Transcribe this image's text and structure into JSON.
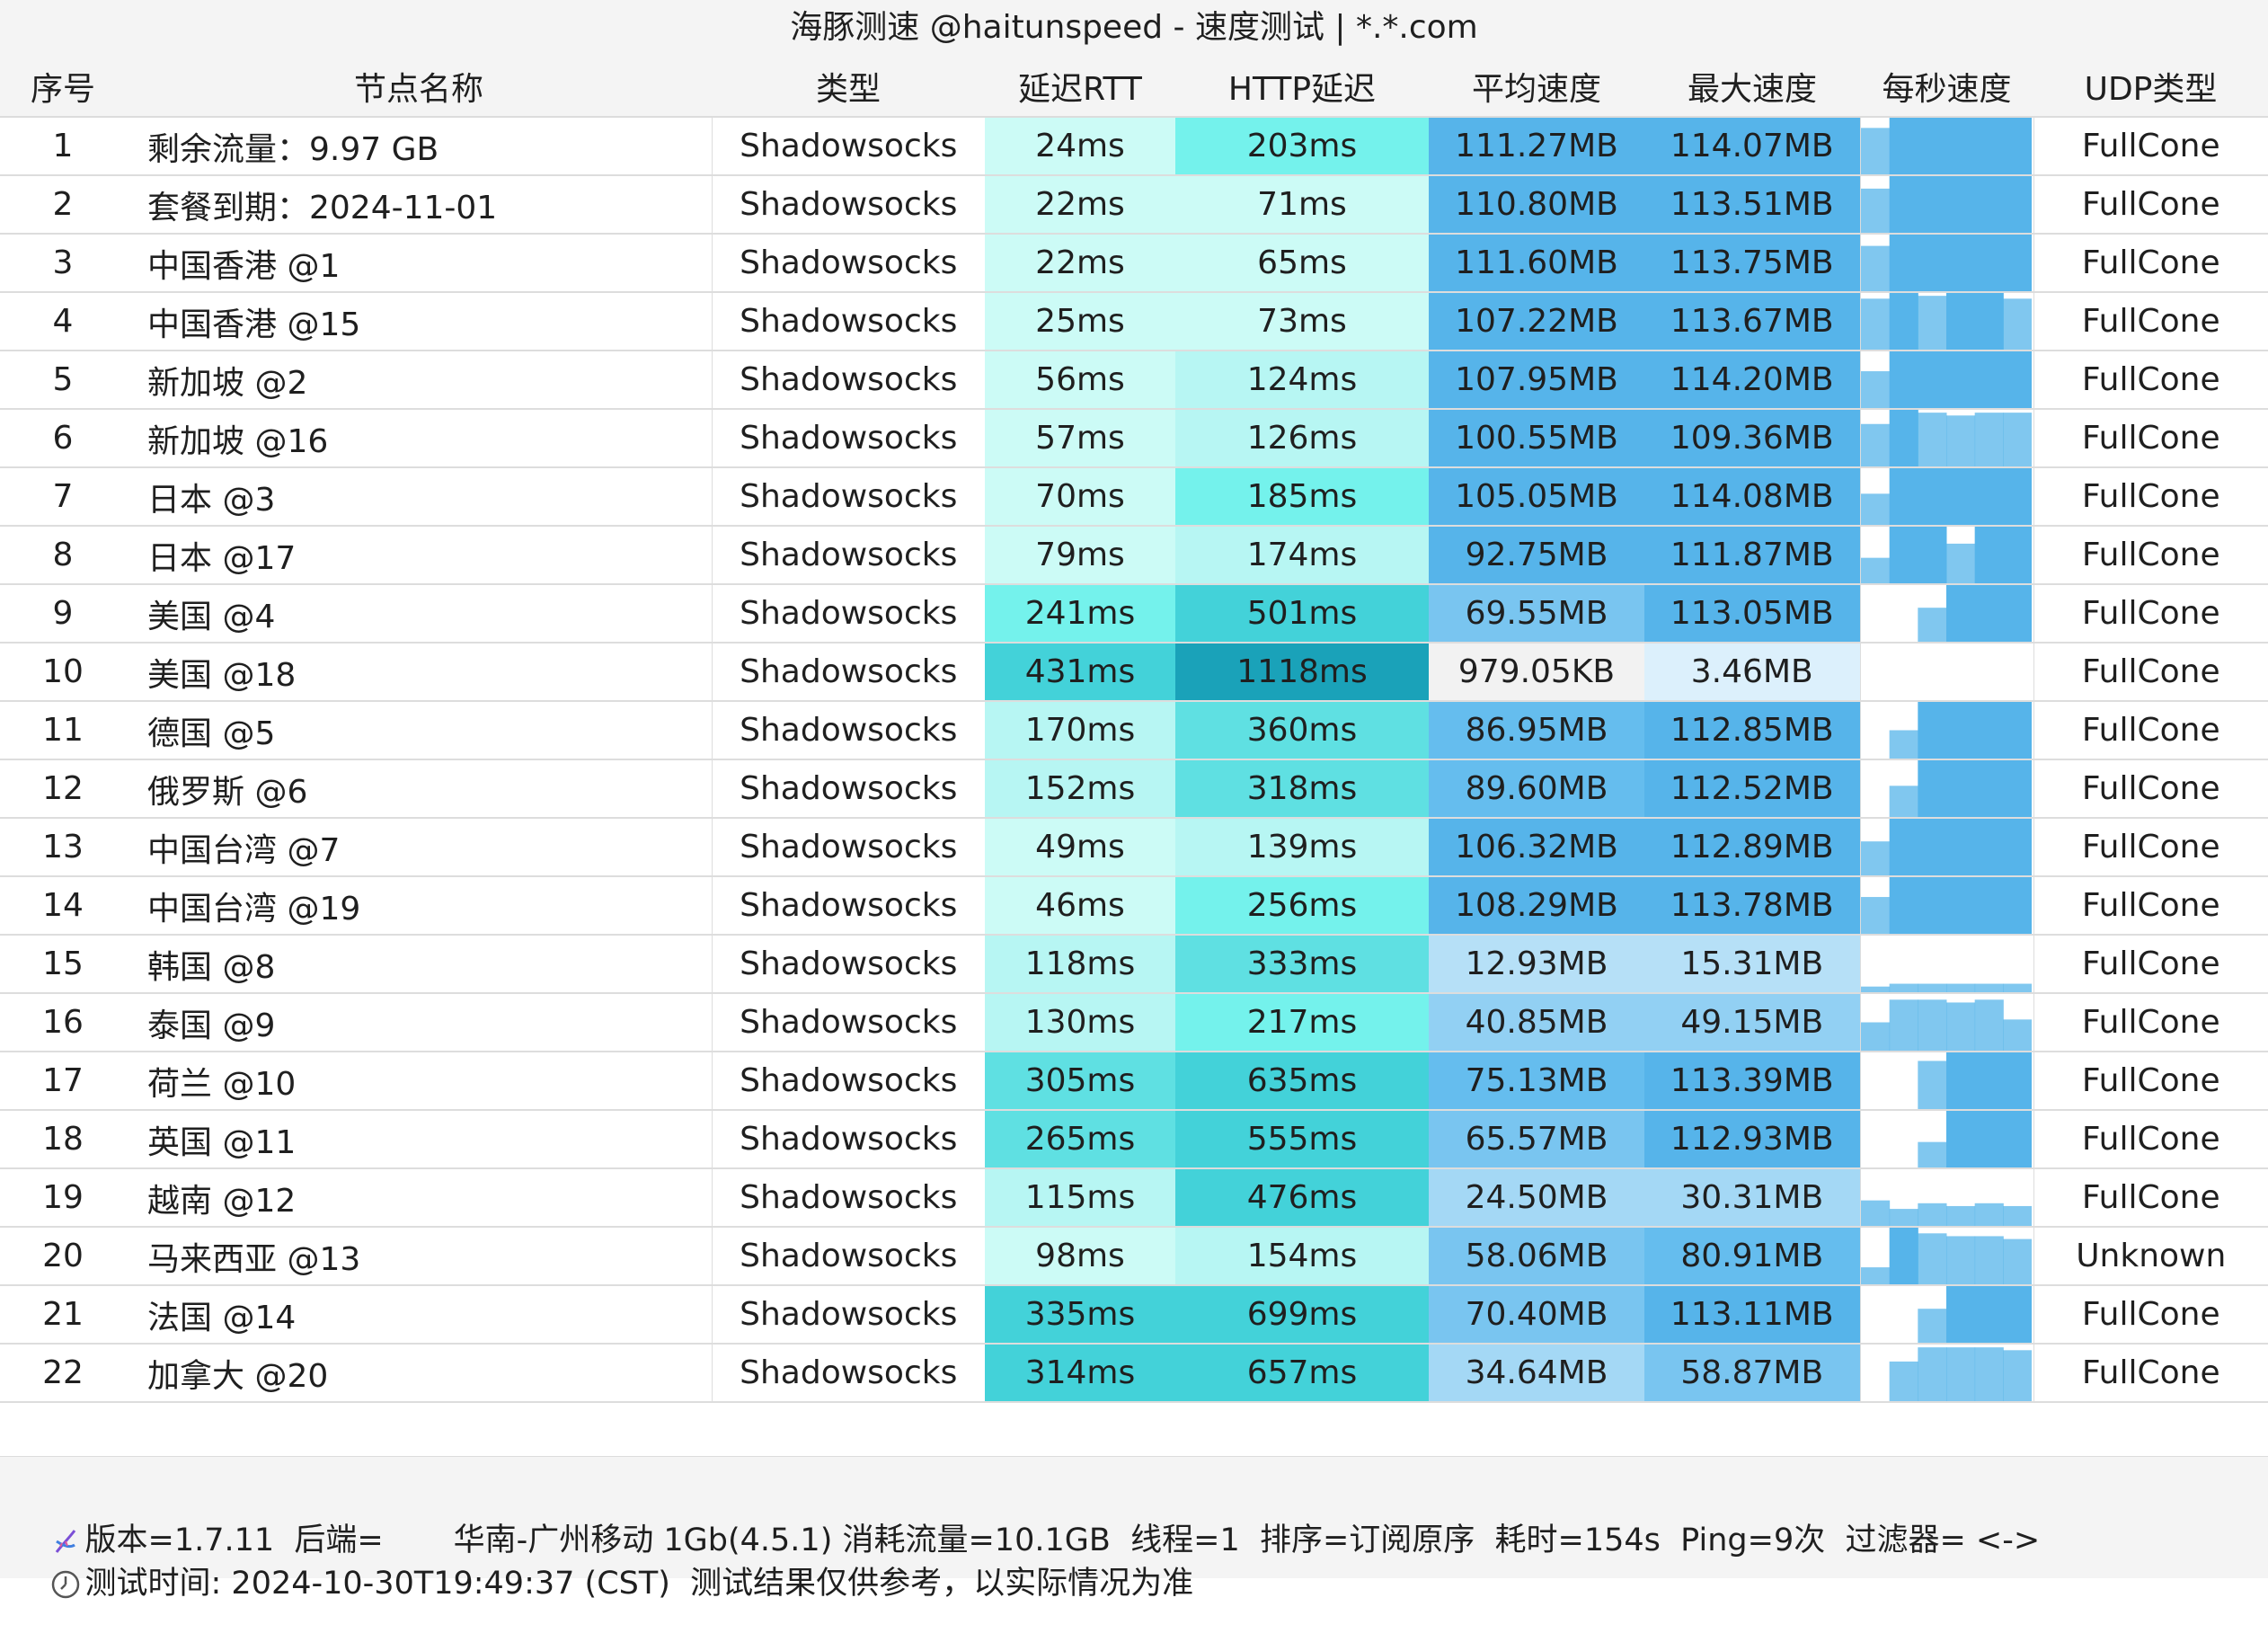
{
  "title": "海豚测速 @haitunspeed - 速度测试 | *.*.com",
  "columns": [
    "序号",
    "节点名称",
    "类型",
    "延迟RTT",
    "HTTP延迟",
    "平均速度",
    "最大速度",
    "每秒速度",
    "UDP类型"
  ],
  "rows": [
    {
      "idx": "1",
      "name": "剩余流量：9.97 GB",
      "type": "Shadowsocks",
      "rtt": "24ms",
      "http": "203ms",
      "avg": "111.27MB",
      "max": "114.07MB",
      "udp": "FullCone",
      "rtt_color": "#ccfbf6",
      "http_color": "#74f2ec",
      "avg_color": "#56b4ea",
      "max_color": "#56b4ea",
      "spark": [
        0.82,
        1,
        1,
        1,
        1,
        1
      ]
    },
    {
      "idx": "2",
      "name": "套餐到期：2024-11-01",
      "type": "Shadowsocks",
      "rtt": "22ms",
      "http": "71ms",
      "avg": "110.80MB",
      "max": "113.51MB",
      "udp": "FullCone",
      "rtt_color": "#ccfbf6",
      "http_color": "#ccfbf6",
      "avg_color": "#56b4ea",
      "max_color": "#56b4ea",
      "spark": [
        0.78,
        1,
        1,
        1,
        1,
        1
      ]
    },
    {
      "idx": "3",
      "name": "中国香港 @1",
      "type": "Shadowsocks",
      "rtt": "22ms",
      "http": "65ms",
      "avg": "111.60MB",
      "max": "113.75MB",
      "udp": "FullCone",
      "rtt_color": "#ccfbf6",
      "http_color": "#ccfbf6",
      "avg_color": "#56b4ea",
      "max_color": "#56b4ea",
      "spark": [
        0.8,
        1,
        1,
        1,
        1,
        1
      ]
    },
    {
      "idx": "4",
      "name": "中国香港 @15",
      "type": "Shadowsocks",
      "rtt": "25ms",
      "http": "73ms",
      "avg": "107.22MB",
      "max": "113.67MB",
      "udp": "FullCone",
      "rtt_color": "#ccfbf6",
      "http_color": "#ccfbf6",
      "avg_color": "#56b4ea",
      "max_color": "#56b4ea",
      "spark": [
        0.9,
        1,
        0.95,
        1,
        1,
        0.9
      ]
    },
    {
      "idx": "5",
      "name": "新加坡 @2",
      "type": "Shadowsocks",
      "rtt": "56ms",
      "http": "124ms",
      "avg": "107.95MB",
      "max": "114.20MB",
      "udp": "FullCone",
      "rtt_color": "#ccfbf6",
      "http_color": "#b7f6f3",
      "avg_color": "#56b4ea",
      "max_color": "#56b4ea",
      "spark": [
        0.65,
        1,
        1,
        1,
        1,
        1
      ]
    },
    {
      "idx": "6",
      "name": "新加坡 @16",
      "type": "Shadowsocks",
      "rtt": "57ms",
      "http": "126ms",
      "avg": "100.55MB",
      "max": "109.36MB",
      "udp": "FullCone",
      "rtt_color": "#ccfbf6",
      "http_color": "#b7f6f3",
      "avg_color": "#56b4ea",
      "max_color": "#56b4ea",
      "spark": [
        0.75,
        1,
        0.95,
        0.9,
        0.95,
        0.95
      ]
    },
    {
      "idx": "7",
      "name": "日本 @3",
      "type": "Shadowsocks",
      "rtt": "70ms",
      "http": "185ms",
      "avg": "105.05MB",
      "max": "114.08MB",
      "udp": "FullCone",
      "rtt_color": "#ccfbf6",
      "http_color": "#74f2ec",
      "avg_color": "#56b4ea",
      "max_color": "#56b4ea",
      "spark": [
        0.55,
        1,
        1,
        1,
        1,
        1
      ]
    },
    {
      "idx": "8",
      "name": "日本 @17",
      "type": "Shadowsocks",
      "rtt": "79ms",
      "http": "174ms",
      "avg": "92.75MB",
      "max": "111.87MB",
      "udp": "FullCone",
      "rtt_color": "#ccfbf6",
      "http_color": "#b7f6f3",
      "avg_color": "#56b4ea",
      "max_color": "#56b4ea",
      "spark": [
        0.45,
        1,
        1,
        0.7,
        1,
        1
      ]
    },
    {
      "idx": "9",
      "name": "美国 @4",
      "type": "Shadowsocks",
      "rtt": "241ms",
      "http": "501ms",
      "avg": "69.55MB",
      "max": "113.05MB",
      "udp": "FullCone",
      "rtt_color": "#74f2ec",
      "http_color": "#43d2d9",
      "avg_color": "#79c5f0",
      "max_color": "#56b4ea",
      "spark": [
        0,
        0,
        0.6,
        1,
        1,
        1
      ]
    },
    {
      "idx": "10",
      "name": "美国 @18",
      "type": "Shadowsocks",
      "rtt": "431ms",
      "http": "1118ms",
      "avg": "979.05KB",
      "max": "3.46MB",
      "udp": "FullCone",
      "rtt_color": "#43d2d9",
      "http_color": "#1aa2b9",
      "avg_color": "#f2f2f2",
      "max_color": "#dcf0fc",
      "spark": [
        0,
        0,
        0,
        0,
        0,
        0
      ]
    },
    {
      "idx": "11",
      "name": "德国 @5",
      "type": "Shadowsocks",
      "rtt": "170ms",
      "http": "360ms",
      "avg": "86.95MB",
      "max": "112.85MB",
      "udp": "FullCone",
      "rtt_color": "#b7f6f3",
      "http_color": "#5fe0e2",
      "avg_color": "#65bdee",
      "max_color": "#56b4ea",
      "spark": [
        0,
        0.5,
        1,
        1,
        1,
        1
      ]
    },
    {
      "idx": "12",
      "name": "俄罗斯 @6",
      "type": "Shadowsocks",
      "rtt": "152ms",
      "http": "318ms",
      "avg": "89.60MB",
      "max": "112.52MB",
      "udp": "FullCone",
      "rtt_color": "#b7f6f3",
      "http_color": "#5fe0e2",
      "avg_color": "#65bdee",
      "max_color": "#56b4ea",
      "spark": [
        0,
        0.55,
        1,
        1,
        1,
        1
      ]
    },
    {
      "idx": "13",
      "name": "中国台湾 @7",
      "type": "Shadowsocks",
      "rtt": "49ms",
      "http": "139ms",
      "avg": "106.32MB",
      "max": "112.89MB",
      "udp": "FullCone",
      "rtt_color": "#ccfbf6",
      "http_color": "#b7f6f3",
      "avg_color": "#56b4ea",
      "max_color": "#56b4ea",
      "spark": [
        0.6,
        1,
        1,
        1,
        1,
        1
      ]
    },
    {
      "idx": "14",
      "name": "中国台湾 @19",
      "type": "Shadowsocks",
      "rtt": "46ms",
      "http": "256ms",
      "avg": "108.29MB",
      "max": "113.78MB",
      "udp": "FullCone",
      "rtt_color": "#ccfbf6",
      "http_color": "#74f2ec",
      "avg_color": "#56b4ea",
      "max_color": "#56b4ea",
      "spark": [
        0.65,
        1,
        1,
        1,
        1,
        1
      ]
    },
    {
      "idx": "15",
      "name": "韩国 @8",
      "type": "Shadowsocks",
      "rtt": "118ms",
      "http": "333ms",
      "avg": "12.93MB",
      "max": "15.31MB",
      "udp": "FullCone",
      "rtt_color": "#b7f6f3",
      "http_color": "#5fe0e2",
      "avg_color": "#b6e0f7",
      "max_color": "#b6e0f7",
      "spark": [
        0.1,
        0.15,
        0.15,
        0.15,
        0.15,
        0.15
      ]
    },
    {
      "idx": "16",
      "name": "泰国 @9",
      "type": "Shadowsocks",
      "rtt": "130ms",
      "http": "217ms",
      "avg": "40.85MB",
      "max": "49.15MB",
      "udp": "FullCone",
      "rtt_color": "#b7f6f3",
      "http_color": "#74f2ec",
      "avg_color": "#92d0f3",
      "max_color": "#92d0f3",
      "spark": [
        0.5,
        0.9,
        0.9,
        0.85,
        0.9,
        0.55
      ]
    },
    {
      "idx": "17",
      "name": "荷兰 @10",
      "type": "Shadowsocks",
      "rtt": "305ms",
      "http": "635ms",
      "avg": "75.13MB",
      "max": "113.39MB",
      "udp": "FullCone",
      "rtt_color": "#5fe0e2",
      "http_color": "#43d2d9",
      "avg_color": "#65bdee",
      "max_color": "#56b4ea",
      "spark": [
        0,
        0,
        0.85,
        1,
        1,
        1
      ]
    },
    {
      "idx": "18",
      "name": "英国 @11",
      "type": "Shadowsocks",
      "rtt": "265ms",
      "http": "555ms",
      "avg": "65.57MB",
      "max": "112.93MB",
      "udp": "FullCone",
      "rtt_color": "#5fe0e2",
      "http_color": "#43d2d9",
      "avg_color": "#79c5f0",
      "max_color": "#56b4ea",
      "spark": [
        0,
        0,
        0.45,
        1,
        1,
        1
      ]
    },
    {
      "idx": "19",
      "name": "越南 @12",
      "type": "Shadowsocks",
      "rtt": "115ms",
      "http": "476ms",
      "avg": "24.50MB",
      "max": "30.31MB",
      "udp": "FullCone",
      "rtt_color": "#b7f6f3",
      "http_color": "#43d2d9",
      "avg_color": "#a4d8f5",
      "max_color": "#a4d8f5",
      "spark": [
        0.45,
        0.3,
        0.4,
        0.35,
        0.4,
        0.35
      ]
    },
    {
      "idx": "20",
      "name": "马来西亚 @13",
      "type": "Shadowsocks",
      "rtt": "98ms",
      "http": "154ms",
      "avg": "58.06MB",
      "max": "80.91MB",
      "udp": "Unknown",
      "rtt_color": "#ccfbf6",
      "http_color": "#b7f6f3",
      "avg_color": "#79c5f0",
      "max_color": "#65bdee",
      "spark": [
        0.3,
        1,
        0.9,
        0.85,
        0.85,
        0.8
      ]
    },
    {
      "idx": "21",
      "name": "法国 @14",
      "type": "Shadowsocks",
      "rtt": "335ms",
      "http": "699ms",
      "avg": "70.40MB",
      "max": "113.11MB",
      "udp": "FullCone",
      "rtt_color": "#43d2d9",
      "http_color": "#43d2d9",
      "avg_color": "#79c5f0",
      "max_color": "#56b4ea",
      "spark": [
        0,
        0,
        0.6,
        1,
        1,
        1
      ]
    },
    {
      "idx": "22",
      "name": "加拿大 @20",
      "type": "Shadowsocks",
      "rtt": "314ms",
      "http": "657ms",
      "avg": "34.64MB",
      "max": "58.87MB",
      "udp": "FullCone",
      "rtt_color": "#43d2d9",
      "http_color": "#43d2d9",
      "avg_color": "#a4d8f5",
      "max_color": "#79c5f0",
      "spark": [
        0,
        0.7,
        0.95,
        0.95,
        0.95,
        0.9
      ]
    }
  ],
  "footer": {
    "line1": "版本=1.7.11  后端=       华南-广州移动 1Gb(4.5.1) 消耗流量=10.1GB  线程=1  排序=订阅原序  耗时=154s  Ping=9次  过滤器= <->",
    "line2": "测试时间: 2024-10-30T19:49:37 (CST)  测试结果仅供参考，以实际情况为准",
    "icon1": "dna-icon",
    "icon2": "clock-icon"
  },
  "colors": {
    "spark_bar": "#56b4ea",
    "header_bg": "#f4f4f4"
  }
}
